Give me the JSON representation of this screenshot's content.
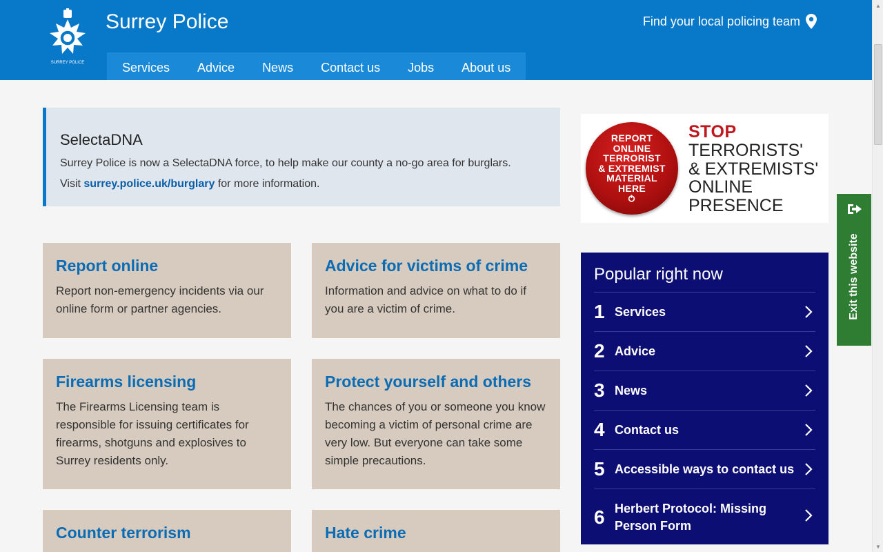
{
  "header": {
    "title": "Surrey Police",
    "local_team": "Find your local policing team",
    "logo_text": "SURREY POLICE"
  },
  "nav": [
    "Services",
    "Advice",
    "News",
    "Contact us",
    "Jobs",
    "About us"
  ],
  "callout": {
    "title": "SelectaDNA",
    "line1": "Surrey Police is now a SelectaDNA force, to help make our county a no-go area for burglars.",
    "visit_prefix": "Visit ",
    "link": "surrey.police.uk/burglary",
    "visit_suffix": " for more information."
  },
  "cards": [
    {
      "title": "Report online",
      "text": "Report non-emergency incidents via our online form or partner agencies."
    },
    {
      "title": "Advice for victims of crime",
      "text": "Information and advice on what to do if you are a victim of crime."
    },
    {
      "title": "Firearms licensing",
      "text": "The Firearms Licensing team is responsible for issuing certificates for firearms, shotguns and explosives to Surrey residents only."
    },
    {
      "title": "Protect yourself and others",
      "text": "The chances of you or someone you know becoming a victim of personal crime are very low. But everyone can take some simple precautions."
    },
    {
      "title": "Counter terrorism",
      "text": ""
    },
    {
      "title": "Hate crime",
      "text": ""
    }
  ],
  "banner": {
    "badge_lines": [
      "REPORT",
      "ONLINE",
      "TERRORIST",
      "& EXTREMIST",
      "MATERIAL",
      "HERE"
    ],
    "stop": "STOP",
    "lines": [
      "TERRORISTS'",
      "& EXTREMISTS'",
      "ONLINE",
      "PRESENCE"
    ]
  },
  "popular": {
    "title": "Popular right now",
    "items": [
      {
        "num": "1",
        "label": "Services"
      },
      {
        "num": "2",
        "label": "Advice"
      },
      {
        "num": "3",
        "label": "News"
      },
      {
        "num": "4",
        "label": "Contact us"
      },
      {
        "num": "5",
        "label": "Accessible ways to contact us"
      },
      {
        "num": "6",
        "label": "Herbert Protocol: Missing Person Form"
      }
    ]
  },
  "exit": {
    "label": "Exit this website"
  },
  "colors": {
    "header": "#0878c8",
    "nav": "#1a8ad8",
    "card": "#d6cbbe",
    "card_title": "#0a6cb4",
    "popular": "#0d0e73",
    "exit": "#2e7d32",
    "stop_red": "#c0161e"
  }
}
